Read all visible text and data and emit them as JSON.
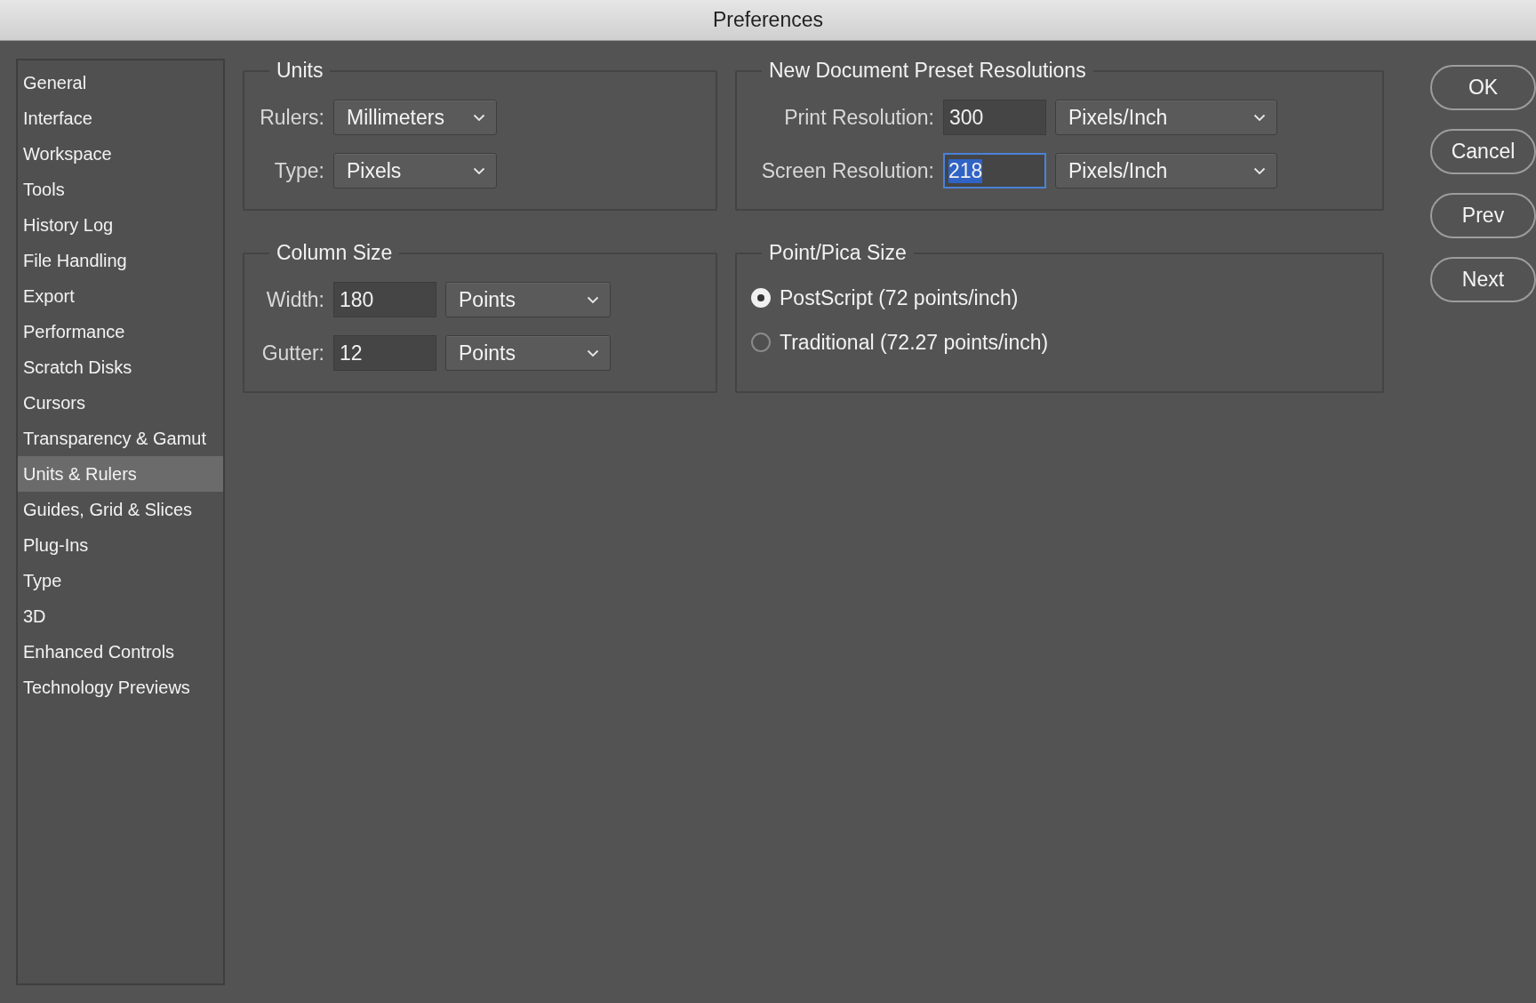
{
  "window": {
    "title": "Preferences"
  },
  "sidebar": {
    "items": [
      {
        "label": "General",
        "selected": false
      },
      {
        "label": "Interface",
        "selected": false
      },
      {
        "label": "Workspace",
        "selected": false
      },
      {
        "label": "Tools",
        "selected": false
      },
      {
        "label": "History Log",
        "selected": false
      },
      {
        "label": "File Handling",
        "selected": false
      },
      {
        "label": "Export",
        "selected": false
      },
      {
        "label": "Performance",
        "selected": false
      },
      {
        "label": "Scratch Disks",
        "selected": false
      },
      {
        "label": "Cursors",
        "selected": false
      },
      {
        "label": "Transparency & Gamut",
        "selected": false
      },
      {
        "label": "Units & Rulers",
        "selected": true
      },
      {
        "label": "Guides, Grid & Slices",
        "selected": false
      },
      {
        "label": "Plug-Ins",
        "selected": false
      },
      {
        "label": "Type",
        "selected": false
      },
      {
        "label": "3D",
        "selected": false
      },
      {
        "label": "Enhanced Controls",
        "selected": false
      },
      {
        "label": "Technology Previews",
        "selected": false
      }
    ]
  },
  "units": {
    "title": "Units",
    "fields": [
      {
        "label": "Rulers:",
        "kind": "dropdown",
        "value": "Millimeters"
      },
      {
        "label": "Type:",
        "kind": "dropdown",
        "value": "Pixels"
      }
    ]
  },
  "new_document_preset_resolutions": {
    "title": "New Document Preset Resolutions",
    "fields": [
      {
        "label": "Print Resolution:",
        "kind": "number",
        "value": "300",
        "unit": "Pixels/Inch",
        "focused": false
      },
      {
        "label": "Screen Resolution:",
        "kind": "number",
        "value": "218",
        "unit": "Pixels/Inch",
        "focused": true
      }
    ]
  },
  "column_size": {
    "title": "Column Size",
    "fields": [
      {
        "label": "Width:",
        "kind": "number",
        "value": "180",
        "unit": "Points",
        "focused": false
      },
      {
        "label": "Gutter:",
        "kind": "number",
        "value": "12",
        "unit": "Points",
        "focused": false
      }
    ]
  },
  "point_pica_size": {
    "title": "Point/Pica Size",
    "options": [
      {
        "label": "PostScript (72 points/inch)",
        "selected": true
      },
      {
        "label": "Traditional (72.27 points/inch)",
        "selected": false
      }
    ]
  },
  "buttons": [
    "OK",
    "Cancel",
    "Prev",
    "Next"
  ]
}
